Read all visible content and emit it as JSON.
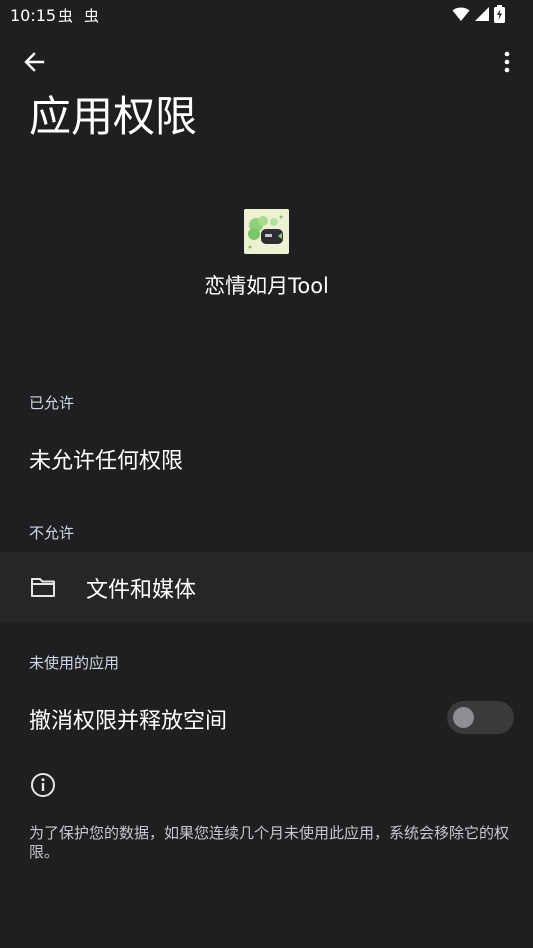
{
  "status_bar": {
    "time": "10:15",
    "notification_glyphs": [
      "虫",
      "虫"
    ],
    "icons": [
      "wifi-icon",
      "cellular-signal-icon",
      "battery-charging-icon"
    ]
  },
  "app_bar": {
    "title": "应用权限",
    "back_icon": "arrow-back-icon",
    "more_icon": "more-vert-icon"
  },
  "app": {
    "name": "恋情如月Tool",
    "icon": "app-icon"
  },
  "sections": {
    "allowed": {
      "header": "已允许",
      "empty_text": "未允许任何权限"
    },
    "denied": {
      "header": "不允许",
      "items": [
        {
          "icon": "folder-icon",
          "label": "文件和媒体"
        }
      ]
    },
    "unused": {
      "header": "未使用的应用",
      "toggle_label": "撤消权限并释放空间",
      "toggle_on": false
    }
  },
  "footnote": {
    "icon": "info-icon",
    "text": "为了保护您的数据，如果您连续几个月未使用此应用，系统会移除它的权限。"
  },
  "colors": {
    "background": "#1f1f21",
    "row_highlight": "#262628",
    "section_header": "#cfd8e6",
    "switch_track": "#3a3a3d",
    "switch_thumb": "#8e8e93"
  }
}
